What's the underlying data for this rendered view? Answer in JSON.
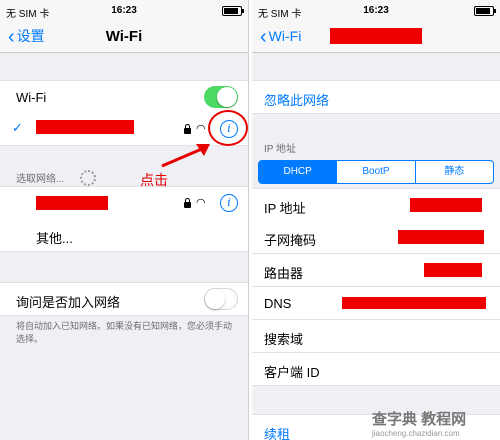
{
  "left": {
    "status": {
      "carrier": "无 SIM 卡 ",
      "time": "16:23",
      "battery_fraction": 0.85
    },
    "nav": {
      "back_label": "设置",
      "title": "Wi-Fi"
    },
    "wifi_toggle_label": "Wi-Fi",
    "wifi_enabled": true,
    "choose_network_header": "选取网络...",
    "other_label": "其他...",
    "ask_join_label": "询问是否加入网络",
    "ask_join_enabled": false,
    "footer_note": "将自动加入已知网络。如果没有已知网络，您必须手动选择。"
  },
  "right": {
    "status": {
      "carrier": "无 SIM 卡 ",
      "time": "16:23",
      "battery_fraction": 0.85
    },
    "nav": {
      "back_label": "Wi-Fi"
    },
    "forget_label": "忽略此网络",
    "ip_header": "IP 地址",
    "segments": [
      "DHCP",
      "BootP",
      "静态"
    ],
    "active_segment": "DHCP",
    "rows": [
      "IP 地址",
      "子网掩码",
      "路由器",
      "DNS",
      "搜索域",
      "客户端 ID"
    ],
    "renew_label": "续租"
  },
  "annotation": {
    "text": "点击",
    "color": "#e60000"
  },
  "watermark": {
    "main": "查字典 教程网",
    "sub": "jiaocheng.chazidian.com"
  },
  "colors": {
    "accent": "#007aff",
    "toggle_on": "#4cd964",
    "redaction": "#ee0000"
  }
}
